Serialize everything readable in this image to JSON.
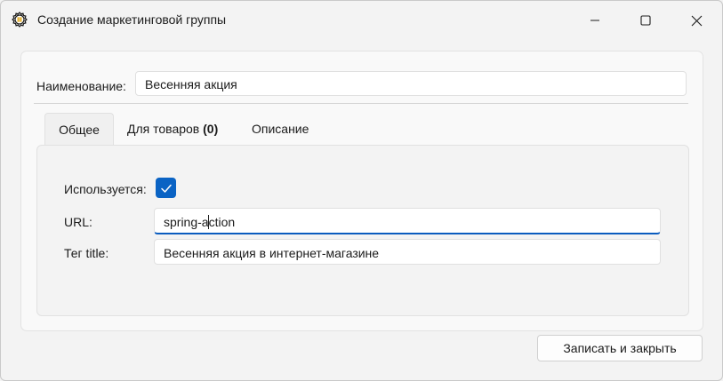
{
  "window": {
    "title": "Создание маркетинговой группы",
    "app_icon": "gear-coin-icon",
    "controls": [
      "minimize-icon",
      "maximize-icon",
      "close-icon"
    ]
  },
  "form": {
    "name_label": "Наименование:",
    "name_value": "Весенняя акция"
  },
  "tabs": {
    "general": "Общее",
    "goods_label": "Для товаров",
    "goods_count": "(0)",
    "description": "Описание",
    "active": "Общее"
  },
  "general": {
    "used_label": "Используется:",
    "used_checked": true,
    "url_label": "URL:",
    "url_before_caret": "spring-a",
    "url_after_caret": "ction",
    "title_label": "Тег title:",
    "title_value": "Весенняя акция в интернет-магазине"
  },
  "footer": {
    "save_label": "Записать и закрыть"
  },
  "colors": {
    "accent": "#0a63c4",
    "background": "#f3f3f3"
  }
}
